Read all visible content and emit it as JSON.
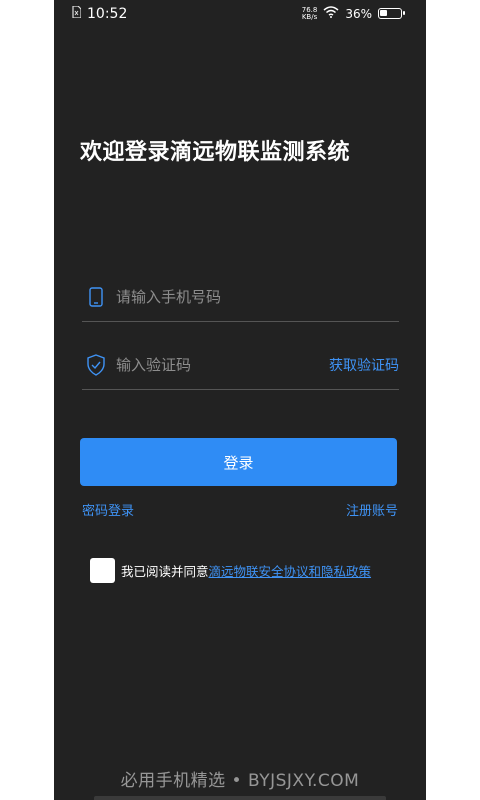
{
  "status_bar": {
    "time": "10:52",
    "net_speed_value": "76.8",
    "net_speed_unit": "KB/s",
    "battery_percent": "36%",
    "battery_level": 0.36
  },
  "login": {
    "title": "欢迎登录滴远物联监测系统",
    "phone_placeholder": "请输入手机号码",
    "code_placeholder": "输入验证码",
    "get_code_label": "获取验证码",
    "login_button": "登录",
    "password_login": "密码登录",
    "register": "注册账号",
    "agree_prefix": "我已阅读并同意",
    "agree_link": "滴远物联安全协议和隐私政策"
  },
  "colors": {
    "accent": "#2f8cf5",
    "background": "#222222"
  },
  "icons": {
    "sim": "sim-card-icon",
    "wifi": "wifi-icon",
    "battery": "battery-icon",
    "phone": "phone-icon",
    "shield": "shield-check-icon"
  },
  "watermark": "必用手机精选 • BYJSJXY.COM"
}
